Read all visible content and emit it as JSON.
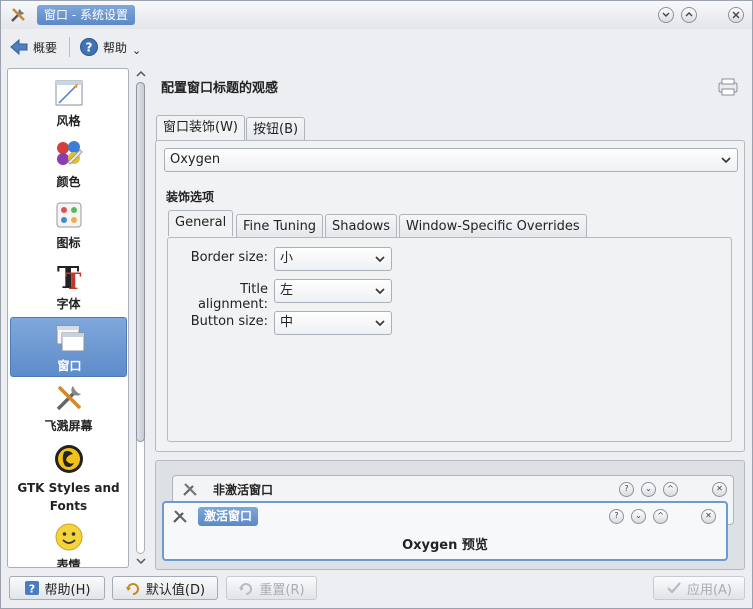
{
  "window": {
    "title": "窗口 - 系统设置",
    "buttons": [
      "?",
      "^"
    ]
  },
  "toolbar": {
    "overview_label": "概要",
    "help_label": "帮助",
    "help_chevron": "⌄"
  },
  "sidebar": {
    "items": [
      {
        "label": "风格",
        "icon": "style-icon"
      },
      {
        "label": "颜色",
        "icon": "color-palette-icon"
      },
      {
        "label": "图标",
        "icon": "icons-icon"
      },
      {
        "label": "字体",
        "icon": "font-icon"
      },
      {
        "label": "窗口",
        "icon": "window-icon",
        "selected": true
      },
      {
        "label": "飞溅屏幕",
        "icon": "splash-screen-icon"
      },
      {
        "label": "GTK Styles and Fonts",
        "icon": "gtk-icon"
      },
      {
        "label": "表情",
        "icon": "emoticon-icon"
      }
    ]
  },
  "main": {
    "heading": "配置窗口标题的观感",
    "tabs": [
      {
        "label": "窗口装饰(W)",
        "active": true
      },
      {
        "label": "按钮(B)",
        "active": false
      }
    ],
    "decoration_combo": "Oxygen",
    "options_heading": "装饰选项",
    "subtabs": [
      {
        "label": "General",
        "active": true
      },
      {
        "label": "Fine Tuning",
        "active": false
      },
      {
        "label": "Shadows",
        "active": false
      },
      {
        "label": "Window-Specific Overrides",
        "active": false
      }
    ],
    "form": {
      "border_size_label": "Border size:",
      "border_size_value": "小",
      "title_alignment_label": "Title alignment:",
      "title_alignment_value": "左",
      "button_size_label": "Button size:",
      "button_size_value": "中"
    }
  },
  "preview": {
    "inactive_title": "非激活窗口",
    "active_title": "激活窗口",
    "caption": "Oxygen 预览",
    "buttons": [
      "?",
      "⌄",
      "^",
      "✕"
    ]
  },
  "footer": {
    "help_button": "帮助(H)",
    "defaults_button": "默认值(D)",
    "reset_button": "重置(R)",
    "apply_button": "应用(A)"
  },
  "colors": {
    "accent": "#5e8ccb",
    "window_bg": "#eceef1"
  }
}
